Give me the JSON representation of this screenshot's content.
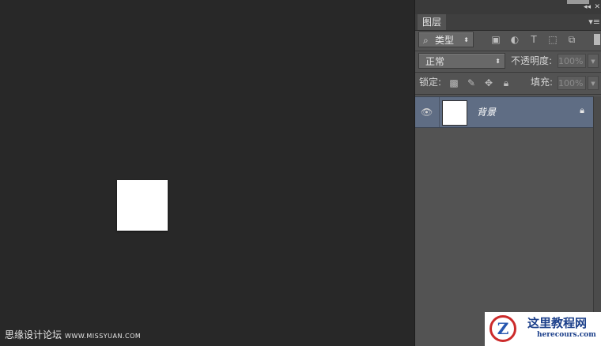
{
  "watermark_left": {
    "cn": "思缘设计论坛",
    "url": "WWW.MISSYUAN.COM"
  },
  "panel": {
    "collapse_label": "◂◂",
    "close_label": "✕",
    "tab_label": "图层",
    "tab_menu_label": "▾≡",
    "filter": {
      "label": "类型",
      "icons": [
        "image-icon",
        "adjustment-icon",
        "type-icon",
        "shape-icon",
        "smart-object-icon"
      ]
    },
    "blend_mode": "正常",
    "opacity_label": "不透明度:",
    "opacity_value": "100%",
    "lock_label": "锁定:",
    "fill_label": "填充:",
    "fill_value": "100%",
    "layers": [
      {
        "name": "背景",
        "visible": true,
        "locked": true
      }
    ]
  },
  "logo": {
    "cn": "这里教程网",
    "en": "herecours.com"
  }
}
